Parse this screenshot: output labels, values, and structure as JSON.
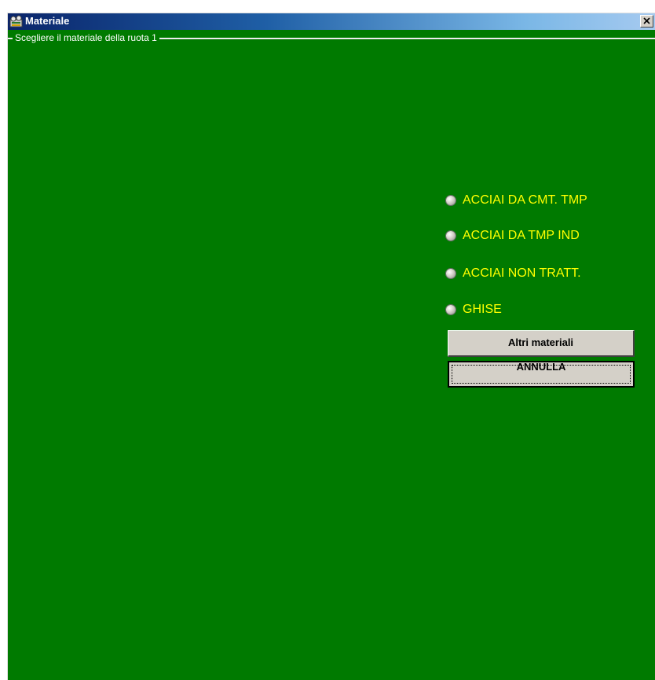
{
  "window": {
    "title": "Materiale",
    "close_glyph": "✕"
  },
  "frame": {
    "caption": "Scegliere il materiale della ruota 1"
  },
  "options": [
    {
      "label": "ACCIAI DA CMT. TMP",
      "selected": false
    },
    {
      "label": "ACCIAI DA TMP IND",
      "selected": false
    },
    {
      "label": "ACCIAI NON TRATT.",
      "selected": false
    },
    {
      "label": "GHISE",
      "selected": false
    }
  ],
  "buttons": {
    "altri_label": "Altri materiali",
    "annulla_label": "ANNULLA"
  },
  "colors": {
    "background": "#007a00",
    "option_text": "#ffff00",
    "caption_text": "#ffffff"
  },
  "icons": {
    "app": "app-icon",
    "close": "close-icon",
    "radio": "radio-icon"
  }
}
